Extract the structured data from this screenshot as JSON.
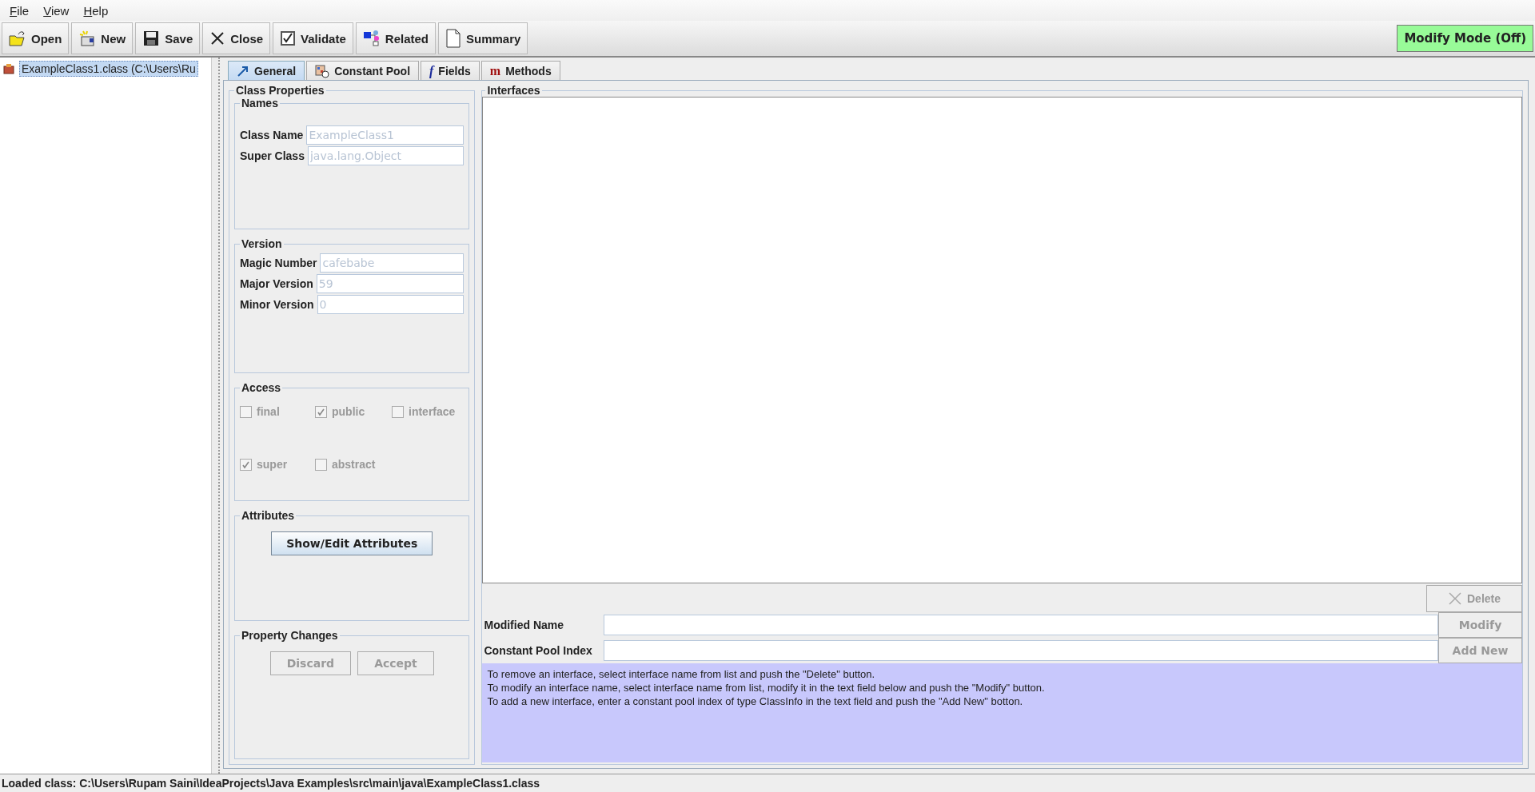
{
  "menu": [
    {
      "label": "File"
    },
    {
      "label": "View"
    },
    {
      "label": "Help"
    }
  ],
  "toolbar": {
    "buttons": [
      {
        "label": "Open"
      },
      {
        "label": "New"
      },
      {
        "label": "Save"
      },
      {
        "label": "Close"
      },
      {
        "label": "Validate"
      },
      {
        "label": "Related"
      },
      {
        "label": "Summary"
      }
    ],
    "mode_button": {
      "label": "Modify Mode (Off)"
    }
  },
  "tree": {
    "items": [
      {
        "label": "ExampleClass1.class (C:\\Users\\Ru",
        "selected": true
      }
    ]
  },
  "tabs": [
    {
      "label": "General",
      "selected": true
    },
    {
      "label": "Constant Pool",
      "selected": false
    },
    {
      "label": "Fields",
      "glyph": "f",
      "selected": false
    },
    {
      "label": "Methods",
      "glyph": "m",
      "selected": false
    }
  ],
  "class_properties": {
    "title": "Class Properties",
    "names": {
      "title": "Names",
      "fields": [
        {
          "label": "Class Name",
          "value": "ExampleClass1",
          "disabled": true
        },
        {
          "label": "Super Class",
          "value": "java.lang.Object",
          "disabled": true
        }
      ]
    },
    "version": {
      "title": "Version",
      "fields": [
        {
          "label": "Magic Number",
          "value": "cafebabe",
          "disabled": true
        },
        {
          "label": "Major Version",
          "value": "59",
          "disabled": true
        },
        {
          "label": "Minor Version",
          "value": "0",
          "disabled": true
        }
      ]
    },
    "access": {
      "title": "Access",
      "checkboxes": [
        {
          "label": "final",
          "checked": false,
          "disabled": true
        },
        {
          "label": "public",
          "checked": true,
          "disabled": true
        },
        {
          "label": "interface",
          "checked": false,
          "disabled": true
        },
        {
          "label": "super",
          "checked": true,
          "disabled": true
        },
        {
          "label": "abstract",
          "checked": false,
          "disabled": true
        }
      ]
    },
    "attributes": {
      "title": "Attributes",
      "button": {
        "label": "Show/Edit Attributes",
        "disabled": false
      }
    },
    "property_changes": {
      "title": "Property Changes",
      "buttons": [
        {
          "label": "Discard",
          "disabled": true
        },
        {
          "label": "Accept",
          "disabled": true
        }
      ]
    }
  },
  "interfaces": {
    "title": "Interfaces",
    "delete_button": {
      "label": "Delete",
      "disabled": true
    },
    "fields": [
      {
        "label": "Modified Name",
        "button": {
          "label": "Modify",
          "disabled": true
        }
      },
      {
        "label": "Constant Pool Index",
        "button": {
          "label": "Add New",
          "disabled": true
        }
      }
    ],
    "help_lines": [
      "To remove an interface, select interface name from list and push the \"Delete\" button.",
      "To modify an interface name, select interface name from list, modify it in the text field below and push the \"Modify\" button.",
      "To add a new interface, enter a constant pool index of type ClassInfo in the text field and push the \"Add New\" botton."
    ]
  },
  "status_bar": "Loaded class: C:\\Users\\Rupam Saini\\IdeaProjects\\Java Examples\\src\\main\\java\\ExampleClass1.class"
}
